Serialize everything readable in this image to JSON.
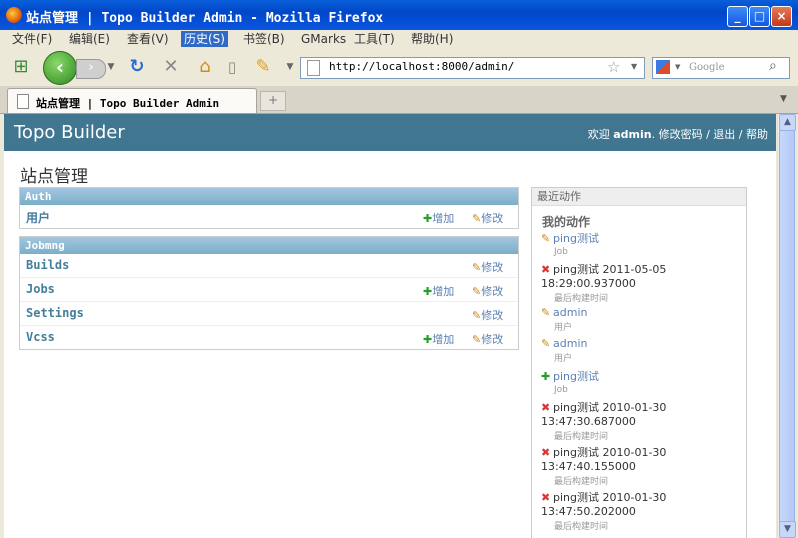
{
  "window": {
    "title": "站点管理 | Topo Builder Admin - Mozilla Firefox",
    "controls": [
      "_",
      "□",
      "×"
    ]
  },
  "menubar": [
    "文件(F)",
    "编辑(E)",
    "查看(V)",
    "历史(S)",
    "书签(B)",
    "GMarks",
    "工具(T)",
    "帮助(H)"
  ],
  "menubar_active": "历史(S)",
  "navbar": {
    "url": "http://localhost:8000/admin/",
    "search_placeholder": "Google"
  },
  "tab": {
    "label": "站点管理 | Topo Builder Admin"
  },
  "admin": {
    "brand": "Topo Builder",
    "welcome": "欢迎",
    "username": "admin",
    "change_password": "修改密码",
    "logout": "退出",
    "help": "帮助",
    "page_title": "站点管理",
    "modules": [
      {
        "caption": "Auth",
        "rows": [
          {
            "name": "用户",
            "add": "增加",
            "change": "修改"
          }
        ]
      },
      {
        "caption": "Jobmng",
        "rows": [
          {
            "name": "Builds",
            "add": "",
            "change": "修改"
          },
          {
            "name": "Jobs",
            "add": "增加",
            "change": "修改"
          },
          {
            "name": "Settings",
            "add": "",
            "change": "修改"
          },
          {
            "name": "Vcss",
            "add": "增加",
            "change": "修改"
          }
        ]
      }
    ],
    "recent": {
      "caption": "最近动作",
      "mine": "我的动作",
      "actions": [
        {
          "icon": "change",
          "text": "ping测试",
          "sub": "Job"
        },
        {
          "icon": "delete",
          "text": "ping测试 2011-05-05 18:29:00.937000",
          "sub": "最后构建时间"
        },
        {
          "icon": "change",
          "text": "admin",
          "sub": "用户"
        },
        {
          "icon": "change",
          "text": "admin",
          "sub": "用户"
        },
        {
          "icon": "add",
          "text": "ping测试",
          "sub": "Job"
        },
        {
          "icon": "delete",
          "text": "ping测试 2010-01-30 13:47:30.687000",
          "sub": "最后构建时间"
        },
        {
          "icon": "delete",
          "text": "ping测试 2010-01-30 13:47:40.155000",
          "sub": "最后构建时间"
        },
        {
          "icon": "delete",
          "text": "ping测试 2010-01-30 13:47:50.202000",
          "sub": "最后构建时间"
        }
      ]
    }
  }
}
